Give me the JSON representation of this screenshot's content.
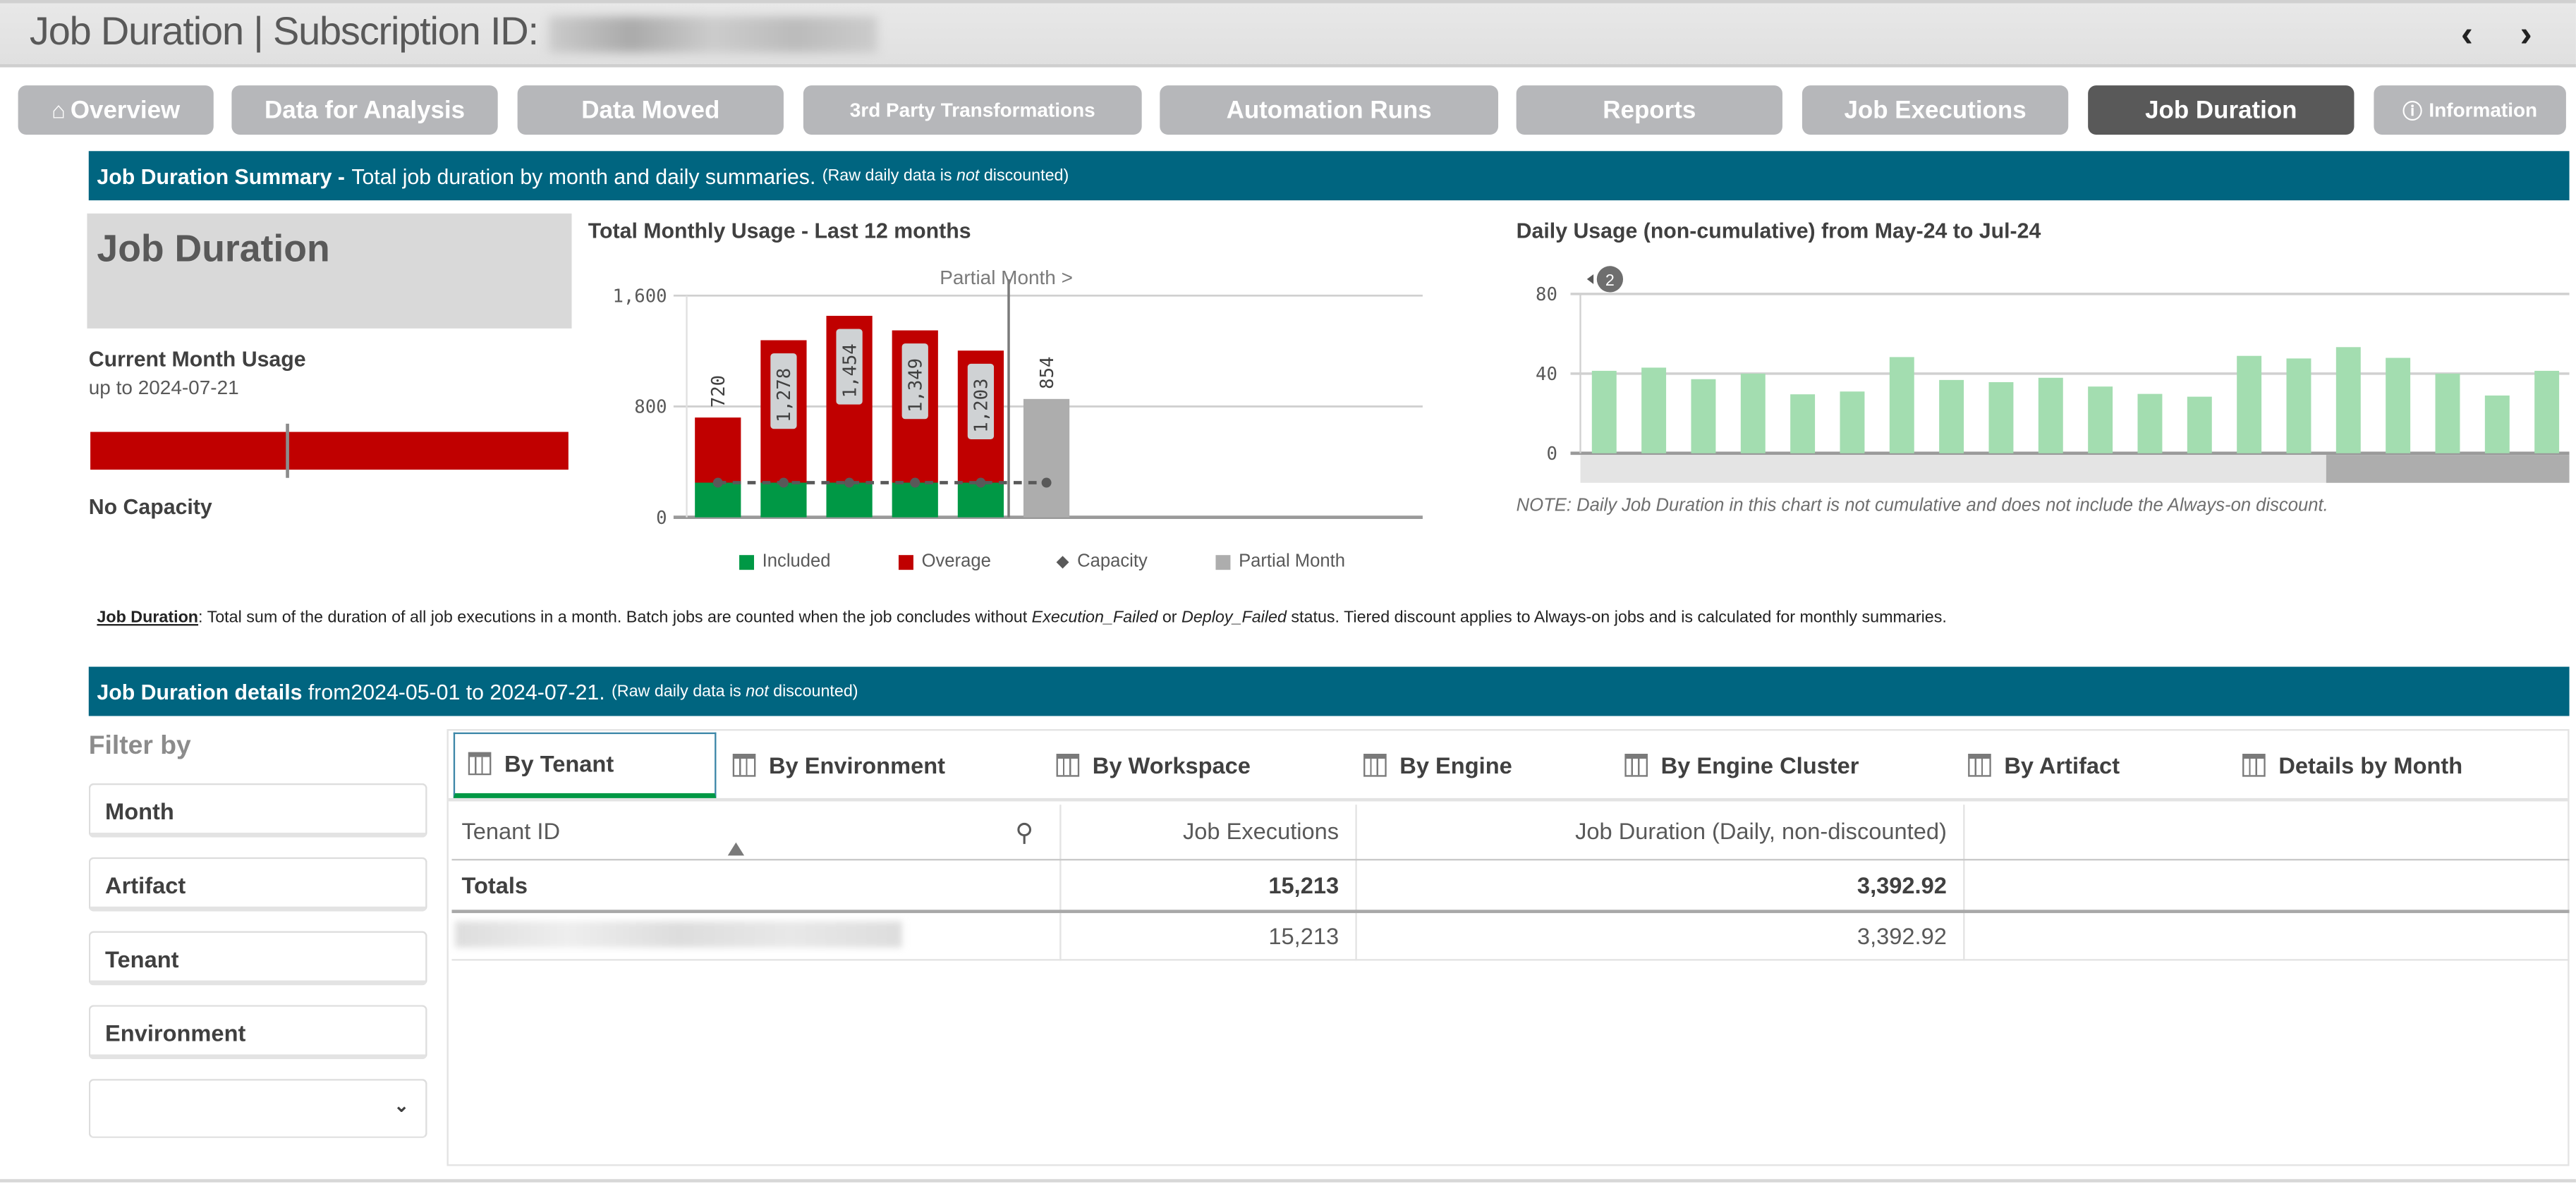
{
  "header": {
    "title": "Job Duration | Subscription ID:",
    "prev_icon": "chevron-left-icon",
    "next_icon": "chevron-right-icon"
  },
  "nav": [
    {
      "label": "Overview",
      "icon": "home-icon"
    },
    {
      "label": "Data for Analysis"
    },
    {
      "label": "Data Moved"
    },
    {
      "label": "3rd Party Transformations"
    },
    {
      "label": "Automation Runs"
    },
    {
      "label": "Reports"
    },
    {
      "label": "Job Executions"
    },
    {
      "label": "Job Duration",
      "active": true
    },
    {
      "label": "Information",
      "icon": "info-icon"
    }
  ],
  "summary_banner": {
    "bold": "Job Duration Summary -",
    "text": "Total job duration by month and daily summaries.",
    "note_pre": "(Raw daily data is ",
    "note_em": "not",
    "note_post": " discounted)"
  },
  "kpi": {
    "title": "Job Duration",
    "usage_label": "Current Month Usage",
    "usage_date": "up to 2024-07-21",
    "capacity_label": "No Capacity",
    "bar_color": "#c00000"
  },
  "chart_data": [
    {
      "type": "bar",
      "title": "Total Monthly Usage - Last 12 months",
      "stacked": true,
      "ylim": [
        0,
        1600
      ],
      "yticks": [
        "1,600",
        "800",
        "0"
      ],
      "annotation": "Partial Month >",
      "series": [
        {
          "name": "Included",
          "color": "#009845",
          "values": [
            250,
            250,
            250,
            250,
            250,
            null
          ]
        },
        {
          "name": "Overage",
          "color": "#c00000",
          "values": [
            470,
            1028,
            1204,
            1099,
            953,
            null
          ]
        },
        {
          "name": "Partial Month",
          "color": "#adadad",
          "values": [
            null,
            null,
            null,
            null,
            null,
            854
          ]
        },
        {
          "name": "Capacity",
          "color": "#595959",
          "values": [
            250,
            250,
            250,
            250,
            250,
            250
          ]
        }
      ],
      "totals": [
        "720",
        "1,278",
        "1,454",
        "1,349",
        "1,203",
        "854"
      ],
      "legend": [
        "Included",
        "Overage",
        "Capacity",
        "Partial Month"
      ],
      "legend_position": "bottom"
    },
    {
      "type": "bar",
      "title": "Daily Usage (non-cumulative) from May-24 to Jul-24",
      "ylim": [
        0,
        80
      ],
      "yticks": [
        "80",
        "40",
        "0"
      ],
      "color": "#a3ddb0",
      "values": [
        41.4,
        43,
        37.2,
        40,
        29.6,
        31,
        48.3,
        36.8,
        35.7,
        37.9,
        33.5,
        29.8,
        28.4,
        48.9,
        47.6,
        53.3,
        47.9,
        40,
        29,
        41.4
      ],
      "badge": "2",
      "note": "NOTE: Daily Job Duration in this chart is not cumulative and does not include the Always-on discount."
    }
  ],
  "footnote": {
    "term": "Job Duration",
    "t1": ": Total sum of the duration of all job executions in a month. Batch jobs are counted when the job concludes without ",
    "e1": "Execution_Failed",
    "t2": " or ",
    "e2": "Deploy_Failed",
    "t3": " status. Tiered discount applies to Always-on jobs and is calculated for monthly summaries."
  },
  "details_banner": {
    "bold": "Job Duration details",
    "text": " from2024-05-01 to 2024-07-21.",
    "note_pre": "(Raw daily data is ",
    "note_em": "not",
    "note_post": " discounted)"
  },
  "filters": {
    "label": "Filter by",
    "items": [
      "Month",
      "Artifact",
      "Tenant",
      "Environment"
    ],
    "dropdown_value": ""
  },
  "tabs": [
    "By Tenant",
    "By Environment",
    "By Workspace",
    "By Engine",
    "By Engine Cluster",
    "By Artifact",
    "Details by Month"
  ],
  "table": {
    "columns": [
      "Tenant ID",
      "Job Executions",
      "Job Duration (Daily, non-discounted)"
    ],
    "totals": {
      "label": "Totals",
      "executions": "15,213",
      "duration": "3,392.92"
    },
    "rows": [
      {
        "executions": "15,213",
        "duration": "3,392.92"
      }
    ]
  }
}
